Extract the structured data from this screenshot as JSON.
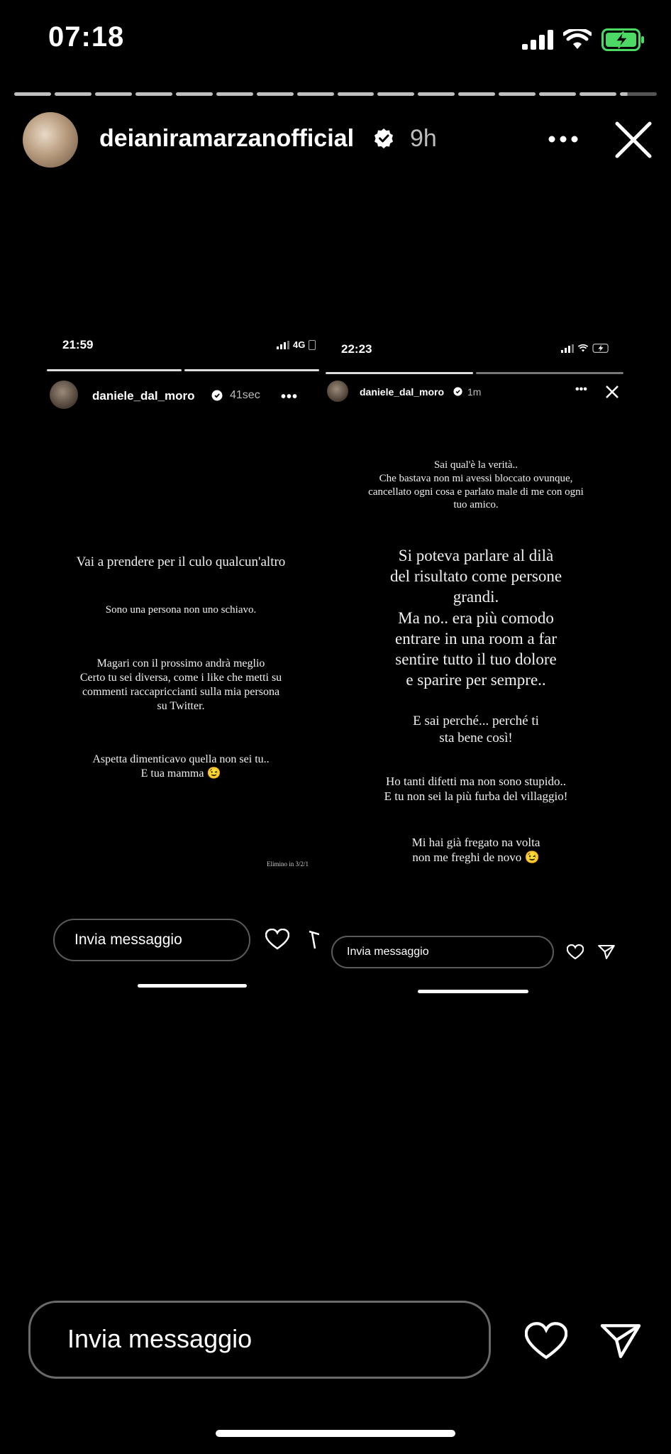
{
  "status_bar": {
    "time": "07:18"
  },
  "story": {
    "username": "deianiramarzanofficial",
    "time_ago": "9h",
    "progress_segments": 16,
    "active_segment": 16
  },
  "left_screenshot": {
    "time": "21:59",
    "network": "4G",
    "username": "daniele_dal_moro",
    "time_ago": "41sec",
    "lines": {
      "l1": "Vai a prendere per il culo qualcun'altro",
      "l2": "Sono una persona non uno schiavo.",
      "l3a": "Magari con il prossimo andrà meglio",
      "l3b": "Certo tu sei diversa, come i like che metti su",
      "l3c": "commenti raccapriccianti sulla mia persona",
      "l3d": "su Twitter.",
      "l4a": "Aspetta dimenticavo quella non sei tu..",
      "l4b": "E tua mamma 😉",
      "footer": "Elimino in 3/2/1"
    },
    "message_placeholder": "Invia messaggio"
  },
  "right_screenshot": {
    "time": "22:23",
    "username": "daniele_dal_moro",
    "time_ago": "1m",
    "lines": {
      "a1": "Sai qual'è la verità..",
      "a2": "Che bastava non mi avessi bloccato ovunque,",
      "a3": "cancellato ogni cosa e parlato male di me con ogni",
      "a4": "tuo amico.",
      "b1": "Si poteva parlare al dilà",
      "b2": "del risultato come persone",
      "b3": "grandi.",
      "b4": "Ma no.. era più comodo",
      "b5": "entrare in una room a far",
      "b6": "sentire tutto il tuo dolore",
      "b7": "e sparire per sempre..",
      "c1": "E sai perché... perché ti",
      "c2": "sta bene così!",
      "d1": "Ho tanti difetti ma non sono stupido..",
      "d2": "E tu non sei la più furba del villaggio!",
      "e1": "Mi hai già fregato na volta",
      "e2": "non me freghi de novo 😉"
    },
    "message_placeholder": "Invia messaggio"
  },
  "bottom": {
    "message_placeholder": "Invia messaggio"
  },
  "colors": {
    "background": "#000000",
    "battery": "#4cd964"
  }
}
